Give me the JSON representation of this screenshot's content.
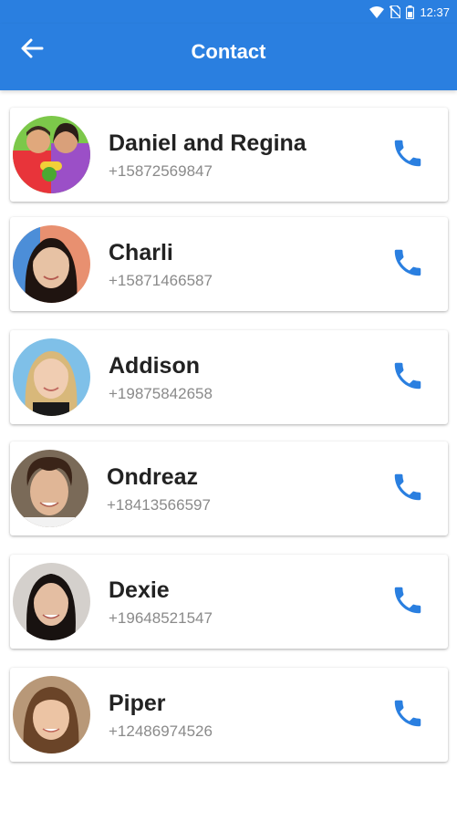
{
  "status_bar": {
    "time": "12:37",
    "icons": [
      "wifi-icon",
      "no-sim-icon",
      "battery-icon"
    ]
  },
  "app_bar": {
    "title": "Contact",
    "back_icon": "arrow-left-icon"
  },
  "colors": {
    "primary": "#2a7fe0",
    "call_icon": "#2a7fe0",
    "name_text": "#222222",
    "phone_text": "#8a8a8a"
  },
  "contacts": [
    {
      "name": "Daniel and Regina",
      "phone": "+15872569847",
      "avatar": "avatar-daniel-and-regina",
      "call_icon": "phone-icon"
    },
    {
      "name": "Charli",
      "phone": "+15871466587",
      "avatar": "avatar-charli",
      "call_icon": "phone-icon"
    },
    {
      "name": "Addison",
      "phone": "+19875842658",
      "avatar": "avatar-addison",
      "call_icon": "phone-icon"
    },
    {
      "name": "Ondreaz",
      "phone": "+18413566597",
      "avatar": "avatar-ondreaz",
      "call_icon": "phone-icon"
    },
    {
      "name": "Dexie",
      "phone": "+19648521547",
      "avatar": "avatar-dexie",
      "call_icon": "phone-icon"
    },
    {
      "name": "Piper",
      "phone": "+12486974526",
      "avatar": "avatar-piper",
      "call_icon": "phone-icon"
    }
  ]
}
